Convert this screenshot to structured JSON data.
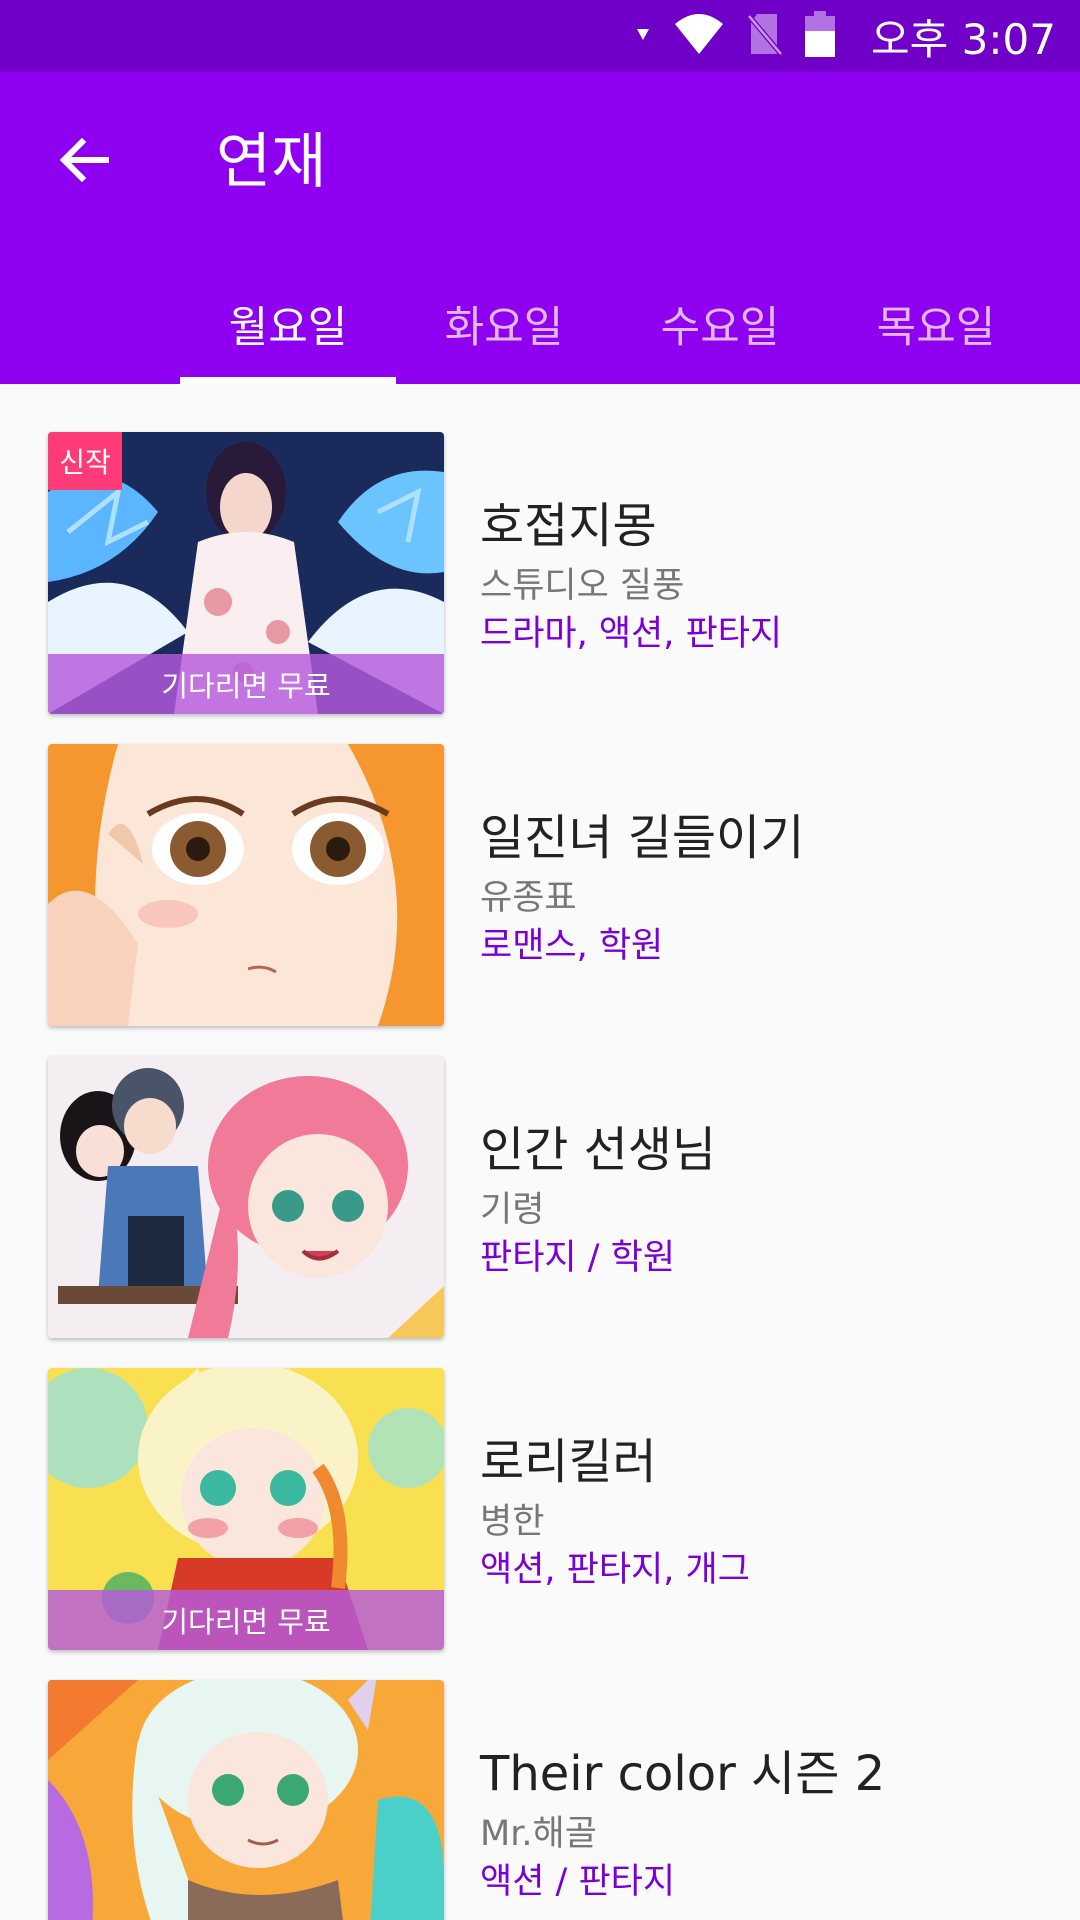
{
  "status_bar": {
    "time": "오후 3:07",
    "icons": [
      "signal-arrow-icon",
      "wifi-icon",
      "no-sim-icon",
      "battery-icon"
    ]
  },
  "app_bar": {
    "back_icon": "arrow-left-icon",
    "title": "연재",
    "tabs": [
      {
        "label": "월요일",
        "active": true
      },
      {
        "label": "화요일",
        "active": false
      },
      {
        "label": "수요일",
        "active": false
      },
      {
        "label": "목요일",
        "active": false
      }
    ]
  },
  "colors": {
    "status_bar": "#7000c8",
    "app_bar": "#8f00f0",
    "genre_text": "#7a00d6",
    "badge_new": "#ff3c78"
  },
  "items": [
    {
      "title": "호접지몽",
      "author": "스튜디오 질풍",
      "genres": "드라마, 액션, 판타지",
      "badge": "신작",
      "footer": "기다리면 무료"
    },
    {
      "title": "일진녀 길들이기",
      "author": "유종표",
      "genres": "로맨스, 학원",
      "badge": "",
      "footer": ""
    },
    {
      "title": "인간 선생님",
      "author": "기령",
      "genres": "판타지 / 학원",
      "badge": "",
      "footer": ""
    },
    {
      "title": "로리킬러",
      "author": "병한",
      "genres": "액션, 판타지, 개그",
      "badge": "",
      "footer": "기다리면 무료"
    },
    {
      "title": "Their color 시즌 2",
      "author": "Mr.해골",
      "genres": "액션 / 판타지",
      "badge": "",
      "footer": ""
    }
  ]
}
